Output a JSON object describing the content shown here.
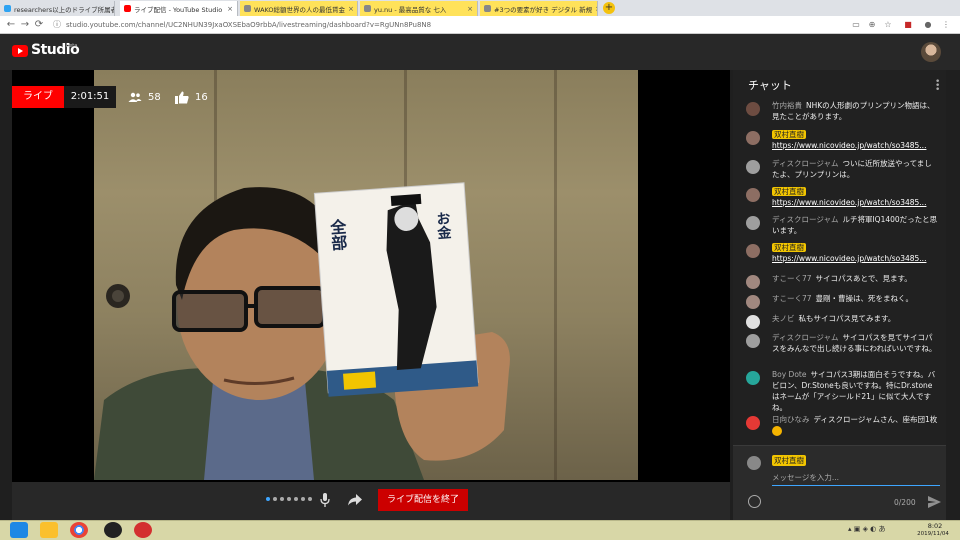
{
  "browser": {
    "tabs": [
      {
        "label": "researchers以上のドライブ所属者",
        "style": "normal"
      },
      {
        "label": "ライブ配信 - YouTube Studio",
        "style": "active"
      },
      {
        "label": "WAKO総額世界の人の最低賃金",
        "style": "yellow"
      },
      {
        "label": "yu.nu - 最高品質な 七入",
        "style": "yellow"
      },
      {
        "label": "#3つの要素が好き デジタル 新規",
        "style": "yellow"
      }
    ],
    "url": "studio.youtube.com/channel/UC2NHUN39JxaOXSEbaO9rbbA/livestreaming/dashboard?v=RgUNn8Pu8N8"
  },
  "studio": {
    "logo_text": "Studio",
    "beta": "beta"
  },
  "stream": {
    "live_label": "ライブ",
    "duration": "2:01:51",
    "viewers": "58",
    "likes": "16",
    "end_button": "ライブ配信を終了"
  },
  "chat": {
    "title": "チャット",
    "messages": [
      {
        "author": "竹内裕貴",
        "owner": false,
        "text": "NHKの人形劇のプリンプリン物語は、見たことがあります。",
        "link": "",
        "avatar": "#6d4c41"
      },
      {
        "author": "双村直樹",
        "owner": true,
        "text": "",
        "link": "https://www.nicovideo.jp/watch/so3485...",
        "avatar": "#8d6e63"
      },
      {
        "author": "ディスクロージャム",
        "owner": false,
        "text": "ついに近所放送やってましたよ、プリンプリンは。",
        "link": "",
        "avatar": "#9e9e9e"
      },
      {
        "author": "双村直樹",
        "owner": true,
        "text": "",
        "link": "https://www.nicovideo.jp/watch/so3485...",
        "avatar": "#8d6e63"
      },
      {
        "author": "ディスクロージャム",
        "owner": false,
        "text": "ルチ将軍IQ1400だったと思います。",
        "link": "",
        "avatar": "#9e9e9e"
      },
      {
        "author": "双村直樹",
        "owner": true,
        "text": "",
        "link": "https://www.nicovideo.jp/watch/so3485...",
        "avatar": "#8d6e63"
      },
      {
        "author": "すこーく77",
        "owner": false,
        "text": "サイコパスあとで、見ます。",
        "link": "",
        "avatar": "#a1887f"
      },
      {
        "author": "すこーく77",
        "owner": false,
        "text": "豊剛・曹操は、死をまねく。",
        "link": "",
        "avatar": "#a1887f"
      },
      {
        "author": "夫ノビ",
        "owner": false,
        "text": "私もサイコパス見てみます。",
        "link": "",
        "avatar": "#e0e0e0"
      },
      {
        "author": "ディスクロージャム",
        "owner": false,
        "text": "サイコパスを見てサイコパスをみんなで出し続ける事にわればいいですね。",
        "link": "",
        "avatar": "#9e9e9e"
      },
      {
        "author": "Boy Dote",
        "owner": false,
        "text": "サイコパス3期は面白そうですね。バビロン、Dr.Stoneも良いですね。特にDr.stoneはネームが「アイシールド21」に似て大人ですね。",
        "link": "",
        "avatar": "#26a69a"
      },
      {
        "author": "日向ひなみ",
        "owner": false,
        "text": "ディスクロージャムさん、座布団1枚",
        "link": "",
        "avatar": "#e53935"
      }
    ],
    "input_name": "双村直樹",
    "input_placeholder": "メッセージを入力...",
    "counter": "0/200"
  },
  "taskbar": {
    "time": "8:02",
    "date": "2019/11/04"
  },
  "colors": {
    "accent_red": "#ff0000",
    "owner_badge": "#f2c500",
    "link_blue": "#3ea6ff"
  }
}
